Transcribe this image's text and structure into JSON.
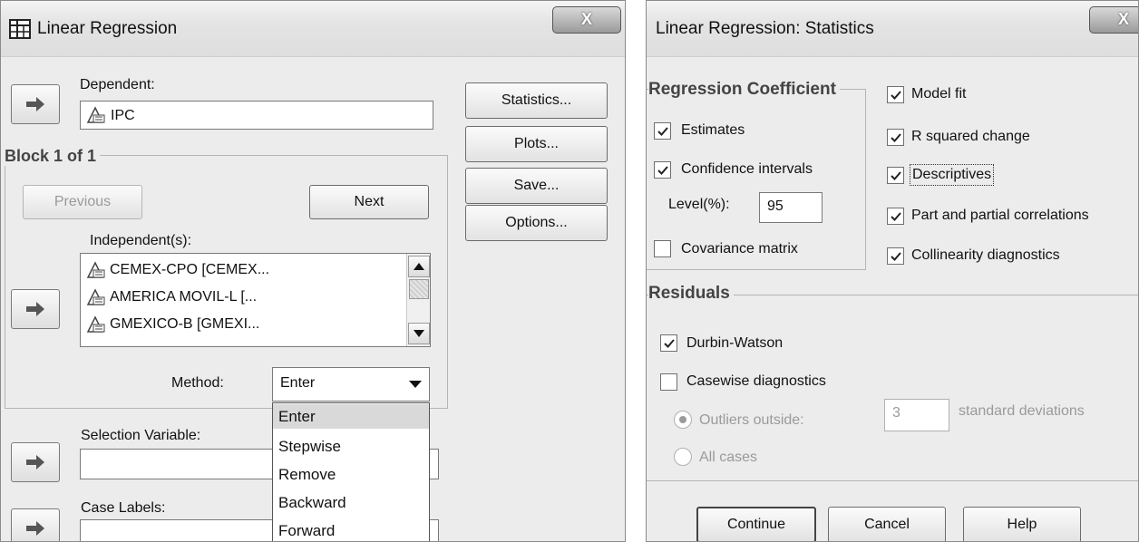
{
  "left_dialog": {
    "title": "Linear Regression",
    "close_label": "X",
    "dependent_label": "Dependent:",
    "dependent_value": "IPC",
    "block_label": "Block 1 of 1",
    "previous_label": "Previous",
    "next_label": "Next",
    "independents_label": "Independent(s):",
    "independents": [
      "CEMEX-CPO [CEMEX...",
      "AMERICA MOVIL-L [...",
      "GMEXICO-B [GMEXI..."
    ],
    "method_label": "Method:",
    "method_value": "Enter",
    "method_options": [
      "Enter",
      "Stepwise",
      "Remove",
      "Backward",
      "Forward"
    ],
    "selection_variable_label": "Selection Variable:",
    "case_labels_label": "Case Labels:",
    "side_buttons": [
      "Statistics...",
      "Plots...",
      "Save...",
      "Options..."
    ]
  },
  "right_dialog": {
    "title": "Linear Regression: Statistics",
    "close_label": "X",
    "coeff_heading": "Regression Coefficient",
    "estimates_label": "Estimates",
    "confidence_label": "Confidence intervals",
    "level_label": "Level(%):",
    "level_value": "95",
    "covariance_label": "Covariance matrix",
    "model_fit_label": "Model fit",
    "r_squared_label": "R squared change",
    "descriptives_label": "Descriptives",
    "part_partial_label": "Part and partial correlations",
    "collinearity_label": "Collinearity diagnostics",
    "residuals_heading": "Residuals",
    "durbin_label": "Durbin-Watson",
    "casewise_label": "Casewise diagnostics",
    "outliers_label": "Outliers outside:",
    "outliers_value": "3",
    "std_dev_label": "standard deviations",
    "all_cases_label": "All cases",
    "continue_label": "Continue",
    "cancel_label": "Cancel",
    "help_label": "Help"
  }
}
